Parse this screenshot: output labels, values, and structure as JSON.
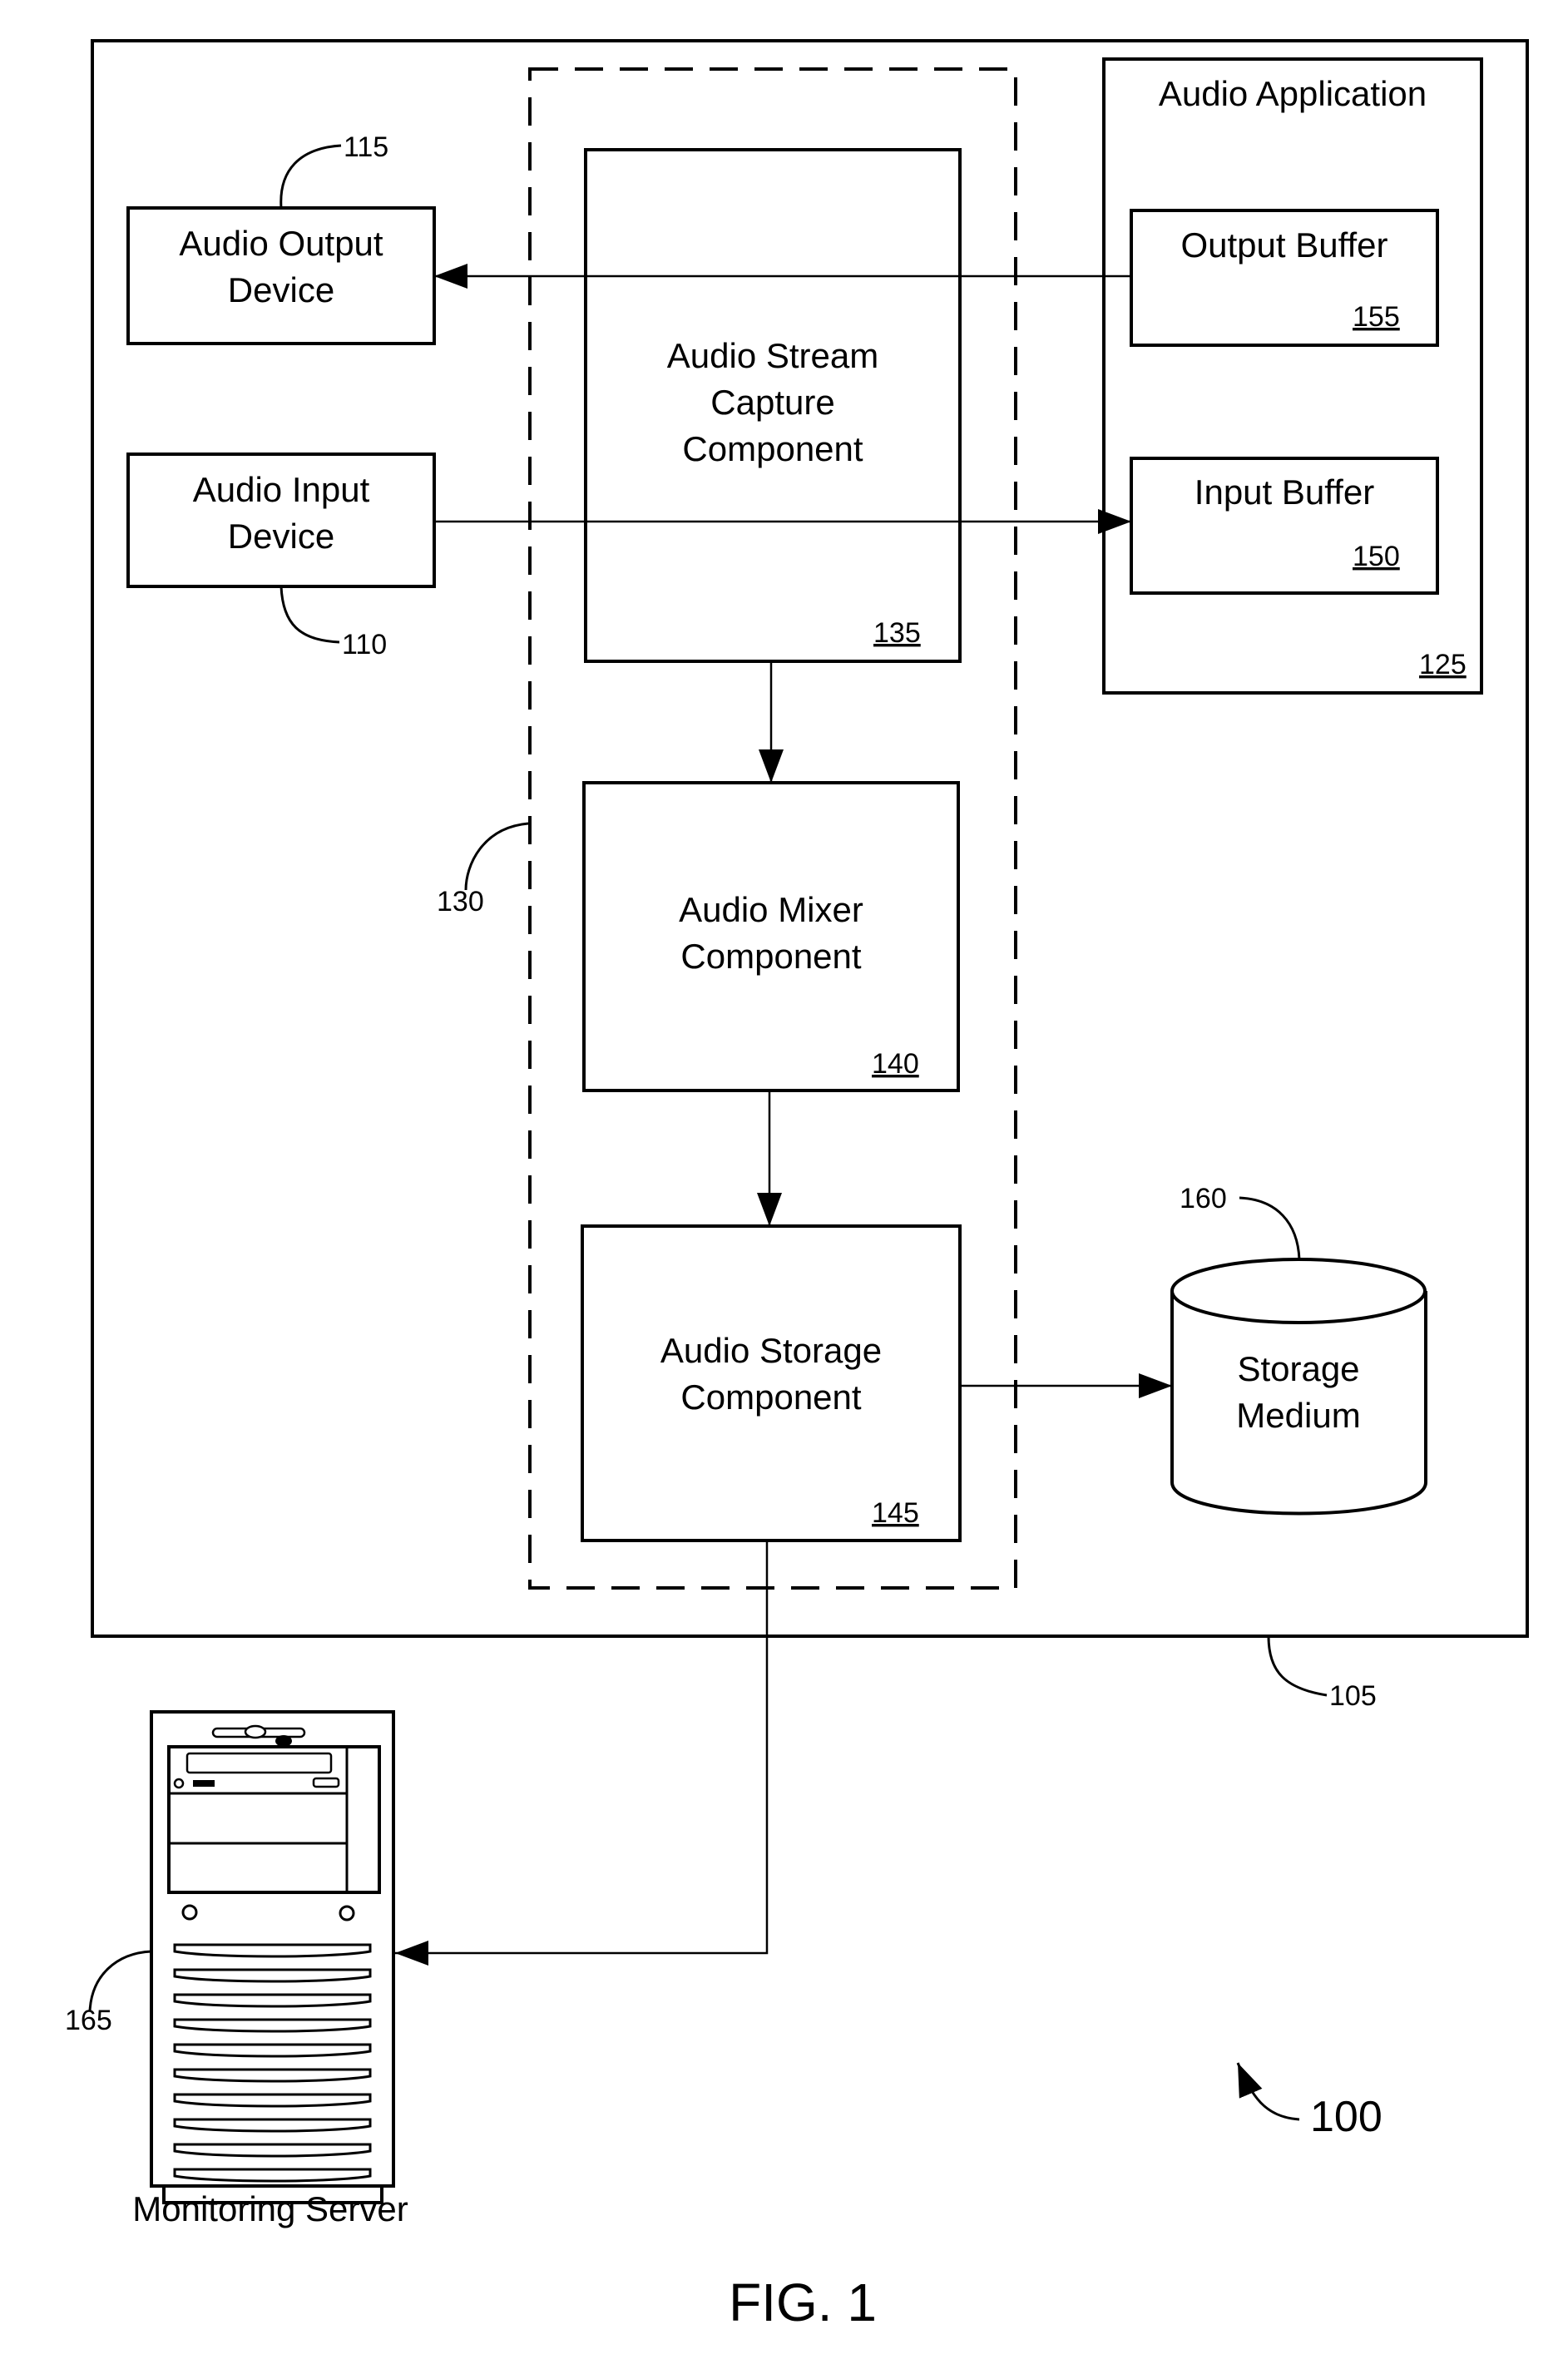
{
  "figure": {
    "caption": "FIG. 1",
    "system_ref": "100"
  },
  "computer": {
    "ref": "105"
  },
  "audio_input_device": {
    "label_line1": "Audio Input",
    "label_line2": "Device",
    "ref": "110"
  },
  "audio_output_device": {
    "label_line1": "Audio Output",
    "label_line2": "Device",
    "ref": "115"
  },
  "audio_application": {
    "label": "Audio Application",
    "ref": "125",
    "output_buffer": {
      "label": "Output Buffer",
      "ref": "155"
    },
    "input_buffer": {
      "label": "Input Buffer",
      "ref": "150"
    }
  },
  "recording_module": {
    "ref": "130"
  },
  "capture_component": {
    "label_line1": "Audio Stream",
    "label_line2": "Capture",
    "label_line3": "Component",
    "ref": "135"
  },
  "mixer_component": {
    "label_line1": "Audio Mixer",
    "label_line2": "Component",
    "ref": "140"
  },
  "storage_component": {
    "label_line1": "Audio Storage",
    "label_line2": "Component",
    "ref": "145"
  },
  "storage_medium": {
    "label_line1": "Storage",
    "label_line2": "Medium",
    "ref": "160"
  },
  "monitoring_server": {
    "label": "Monitoring Server",
    "ref": "165"
  }
}
